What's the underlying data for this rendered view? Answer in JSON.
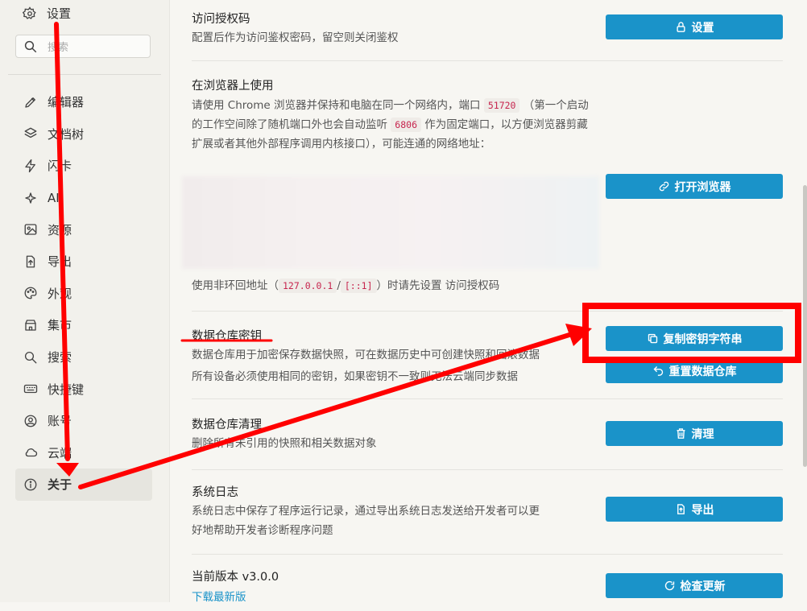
{
  "sidebar": {
    "title": "设置",
    "search_placeholder": "搜索",
    "items": [
      {
        "label": "编辑器",
        "icon": "pen-icon"
      },
      {
        "label": "文档树",
        "icon": "layers-icon"
      },
      {
        "label": "闪卡",
        "icon": "bolt-icon"
      },
      {
        "label": "AI",
        "icon": "sparkle-icon"
      },
      {
        "label": "资源",
        "icon": "image-icon"
      },
      {
        "label": "导出",
        "icon": "export-file-icon"
      },
      {
        "label": "外观",
        "icon": "palette-icon"
      },
      {
        "label": "集市",
        "icon": "store-icon"
      },
      {
        "label": "搜索",
        "icon": "search-icon"
      },
      {
        "label": "快捷键",
        "icon": "keyboard-icon"
      },
      {
        "label": "账号",
        "icon": "user-icon"
      },
      {
        "label": "云端",
        "icon": "cloud-icon"
      },
      {
        "label": "关于",
        "icon": "info-icon",
        "active": true
      }
    ]
  },
  "access": {
    "title": "访问授权码",
    "desc": "配置后作为访问鉴权密码，留空则关闭鉴权",
    "button": "设置"
  },
  "browser": {
    "title": "在浏览器上使用",
    "desc_1": "请使用 Chrome 浏览器并保持和电脑在同一个网络内，端口",
    "port": "51720",
    "desc_2": "（第一个启动的工作空间除了随机端口外也会自动监听",
    "fixed_port": "6806",
    "desc_3": "作为固定端口，以方便浏览器剪藏扩展或者其他外部程序调用内核接口），可能连通的网络地址：",
    "loopback_prefix": "使用非环回地址（",
    "loop_1": "127.0.0.1",
    "slash": "/",
    "loop_2": "[::1]",
    "loopback_suffix": "）时请先设置 访问授权码",
    "button": "打开浏览器"
  },
  "repo_key": {
    "title": "数据仓库密钥",
    "desc": "数据仓库用于加密保存数据快照，可在数据历史中可创建快照和回滚数据",
    "warning": "所有设备必须使用相同的密钥，如果密钥不一致则无法云端同步数据",
    "button_copy": "复制密钥字符串",
    "button_reset": "重置数据仓库"
  },
  "repo_purge": {
    "title": "数据仓库清理",
    "desc": "删除所有未引用的快照和相关数据对象",
    "button": "清理"
  },
  "syslog": {
    "title": "系统日志",
    "desc_1": "系统日志中保存了程序运行记录，通过导出系统日志发送给开发者可以更",
    "desc_2": "好地帮助开发者诊断程序问题",
    "button": "导出"
  },
  "version": {
    "title": "当前版本 v3.0.0",
    "link": "下载最新版",
    "button": "检查更新"
  },
  "colors": {
    "accent": "#1a93c9",
    "annotation": "#ff0000",
    "warning": "#d9534f"
  }
}
